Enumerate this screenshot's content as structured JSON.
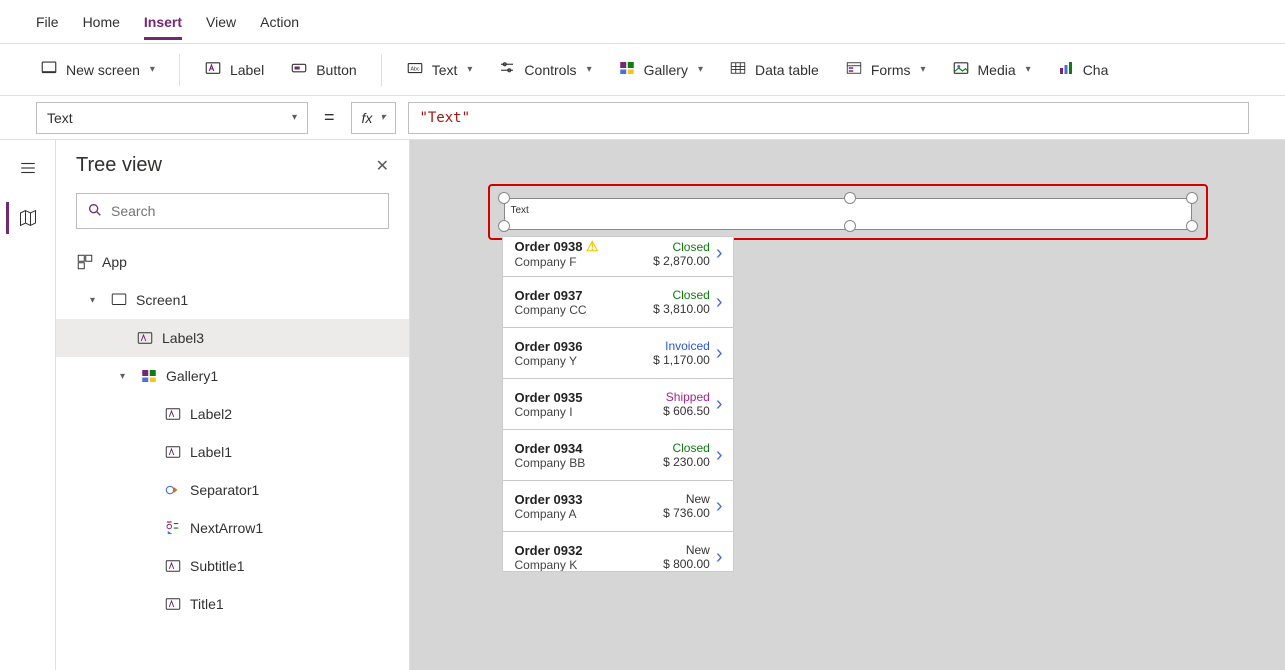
{
  "menus": {
    "file": "File",
    "home": "Home",
    "insert": "Insert",
    "view": "View",
    "action": "Action"
  },
  "ribbon": {
    "new_screen": "New screen",
    "label": "Label",
    "button": "Button",
    "text": "Text",
    "controls": "Controls",
    "gallery": "Gallery",
    "data_table": "Data table",
    "forms": "Forms",
    "media": "Media",
    "chart": "Cha"
  },
  "formula": {
    "property": "Text",
    "fx": "fx",
    "value": "\"Text\""
  },
  "tree": {
    "title": "Tree view",
    "search_placeholder": "Search",
    "items": {
      "app": "App",
      "screen1": "Screen1",
      "label3": "Label3",
      "gallery1": "Gallery1",
      "label2": "Label2",
      "label1": "Label1",
      "separator1": "Separator1",
      "nextarrow1": "NextArrow1",
      "subtitle1": "Subtitle1",
      "title1": "Title1"
    }
  },
  "canvas": {
    "label_text": "Text"
  },
  "gallery": [
    {
      "title": "Order 0938",
      "sub": "Company F",
      "status": "Closed",
      "status_color": "#107c10",
      "amount": "$ 2,870.00",
      "warn": true
    },
    {
      "title": "Order 0937",
      "sub": "Company CC",
      "status": "Closed",
      "status_color": "#107c10",
      "amount": "$ 3,810.00"
    },
    {
      "title": "Order 0936",
      "sub": "Company Y",
      "status": "Invoiced",
      "status_color": "#2b56d6",
      "amount": "$ 1,170.00"
    },
    {
      "title": "Order 0935",
      "sub": "Company I",
      "status": "Shipped",
      "status_color": "#a4268c",
      "amount": "$ 606.50"
    },
    {
      "title": "Order 0934",
      "sub": "Company BB",
      "status": "Closed",
      "status_color": "#107c10",
      "amount": "$ 230.00"
    },
    {
      "title": "Order 0933",
      "sub": "Company A",
      "status": "New",
      "status_color": "#333333",
      "amount": "$ 736.00"
    },
    {
      "title": "Order 0932",
      "sub": "Company K",
      "status": "New",
      "status_color": "#333333",
      "amount": "$ 800.00"
    }
  ]
}
